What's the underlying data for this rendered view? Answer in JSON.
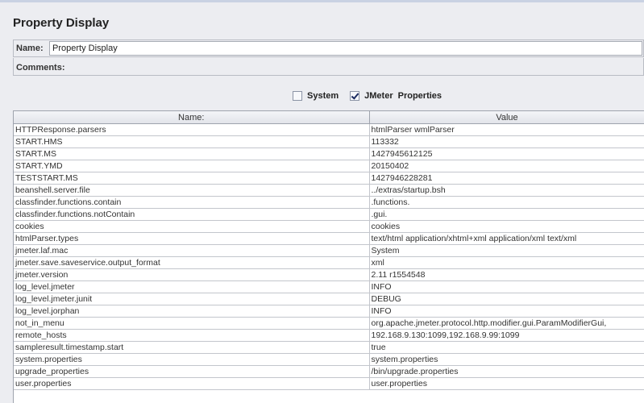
{
  "panel": {
    "title": "Property Display",
    "name_label": "Name:",
    "name_value": "Property Display",
    "comments_label": "Comments:"
  },
  "options": {
    "system_label": "System",
    "system_checked": false,
    "jmeter_label": "JMeter",
    "properties_label": "Properties",
    "jmeter_checked": true
  },
  "table": {
    "columns": [
      "Name:",
      "Value"
    ],
    "rows": [
      [
        "HTTPResponse.parsers",
        "htmlParser wmlParser"
      ],
      [
        "START.HMS",
        "113332"
      ],
      [
        "START.MS",
        "1427945612125"
      ],
      [
        "START.YMD",
        "20150402"
      ],
      [
        "TESTSTART.MS",
        "1427946228281"
      ],
      [
        "beanshell.server.file",
        "../extras/startup.bsh"
      ],
      [
        "classfinder.functions.contain",
        ".functions."
      ],
      [
        "classfinder.functions.notContain",
        ".gui."
      ],
      [
        "cookies",
        "cookies"
      ],
      [
        "htmlParser.types",
        "text/html application/xhtml+xml application/xml text/xml"
      ],
      [
        "jmeter.laf.mac",
        "System"
      ],
      [
        "jmeter.save.saveservice.output_format",
        "xml"
      ],
      [
        "jmeter.version",
        "2.11 r1554548"
      ],
      [
        "log_level.jmeter",
        "INFO"
      ],
      [
        "log_level.jmeter.junit",
        "DEBUG"
      ],
      [
        "log_level.jorphan",
        "INFO"
      ],
      [
        "not_in_menu",
        "org.apache.jmeter.protocol.http.modifier.gui.ParamModifierGui,"
      ],
      [
        "remote_hosts",
        "192.168.9.130:1099,192.168.9.99:1099"
      ],
      [
        "sampleresult.timestamp.start",
        "true"
      ],
      [
        "system.properties",
        "system.properties"
      ],
      [
        "upgrade_properties",
        "/bin/upgrade.properties"
      ],
      [
        "user.properties",
        "user.properties"
      ]
    ]
  }
}
